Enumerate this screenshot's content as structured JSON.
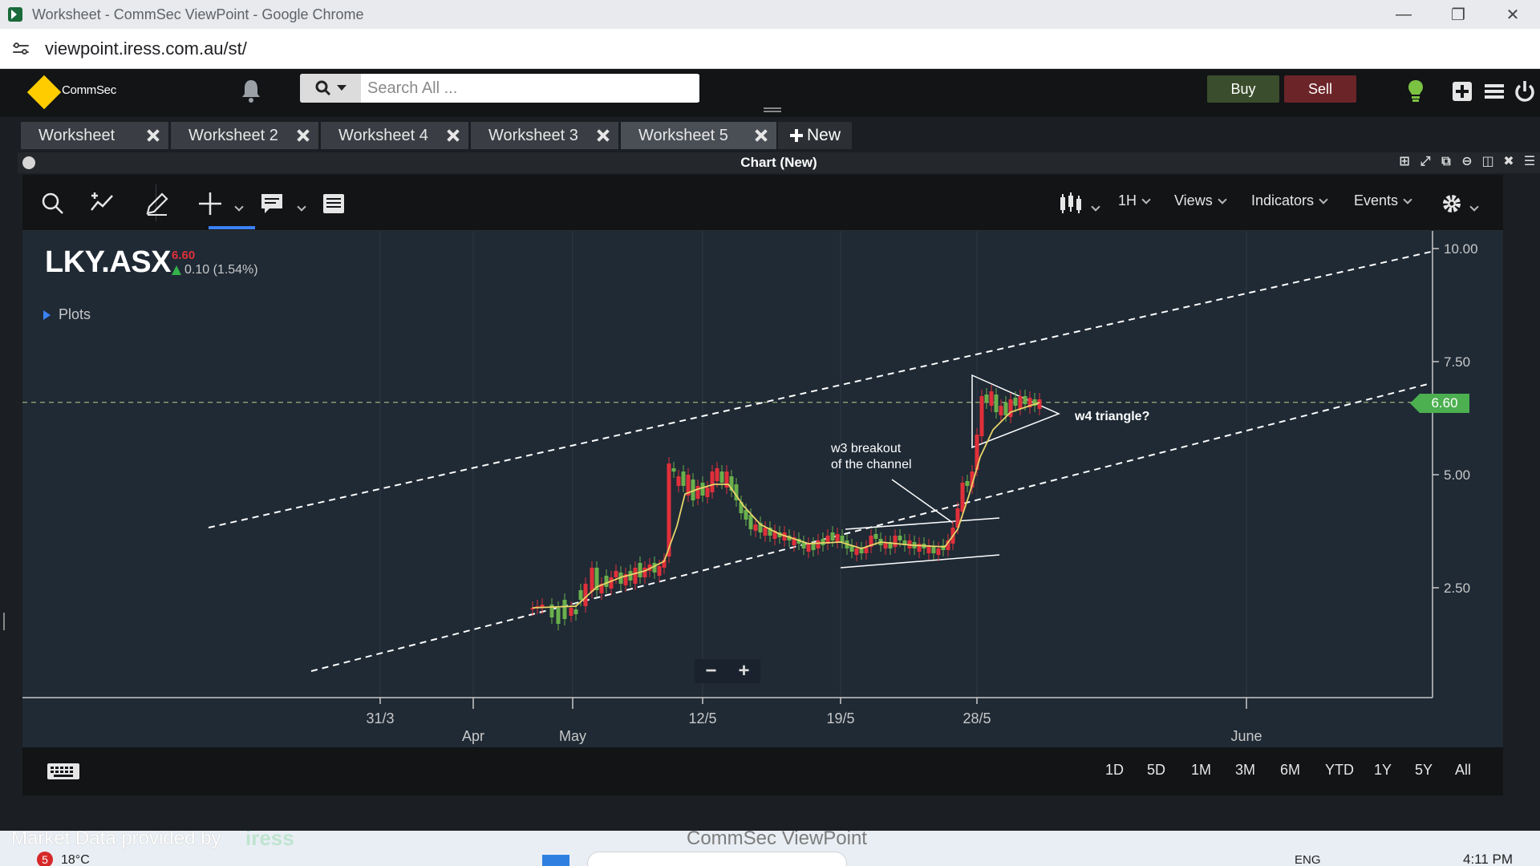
{
  "browser": {
    "window_title": "Worksheet - CommSec ViewPoint - Google Chrome",
    "url": "viewpoint.iress.com.au/st/",
    "controls": {
      "minimize": "—",
      "restore": "❐",
      "close": "✕"
    }
  },
  "header": {
    "brand": "CommSec",
    "search_placeholder": "Search All ...",
    "buy_label": "Buy",
    "sell_label": "Sell"
  },
  "worksheets": {
    "tabs": [
      {
        "label": "Worksheet"
      },
      {
        "label": "Worksheet 2"
      },
      {
        "label": "Worksheet 4"
      },
      {
        "label": "Worksheet 3"
      },
      {
        "label": "Worksheet 5"
      }
    ],
    "active_index": 4,
    "new_label": "New"
  },
  "panel": {
    "title": "Chart (New)"
  },
  "toolbar": {
    "interval": "1H",
    "views": "Views",
    "indicators": "Indicators",
    "events": "Events"
  },
  "quote": {
    "symbol": "LKY.ASX",
    "last": "6.60",
    "change": "0.10 (1.54%)",
    "plots_label": "Plots"
  },
  "ranges": [
    "1D",
    "5D",
    "1M",
    "3M",
    "6M",
    "YTD",
    "1Y",
    "5Y",
    "All"
  ],
  "colors": {
    "up_candle": "#6ab04c",
    "down_candle": "#e0303a",
    "ma_line": "#e8d46a",
    "price_tag": "#4caf50",
    "last_price": "#e0303a"
  },
  "chart_data": {
    "type": "candlestick",
    "y_ticks": [
      "10.00",
      "7.50",
      "5.00",
      "2.50"
    ],
    "ylim": [
      0,
      10.5
    ],
    "x_ticks": [
      {
        "label": "31/3",
        "row": 1
      },
      {
        "label": "Apr",
        "row": 2
      },
      {
        "label": "May",
        "row": 2
      },
      {
        "label": "12/5",
        "row": 1
      },
      {
        "label": "19/5",
        "row": 1
      },
      {
        "label": "28/5",
        "row": 1
      },
      {
        "label": "June",
        "row": 2
      }
    ],
    "last_price": 6.6,
    "last_price_label": "6.60",
    "annotations": [
      {
        "text": [
          "w3 breakout",
          "of the channel"
        ]
      },
      {
        "text": [
          "w4 triangle?"
        ]
      }
    ]
  },
  "taskbar": {
    "market_data": "Market Data provided by",
    "provider": "iress",
    "app": "CommSec ViewPoint",
    "weather_badge": "5",
    "temperature": "18°C",
    "language": "ENG",
    "time": "4:11 PM"
  }
}
